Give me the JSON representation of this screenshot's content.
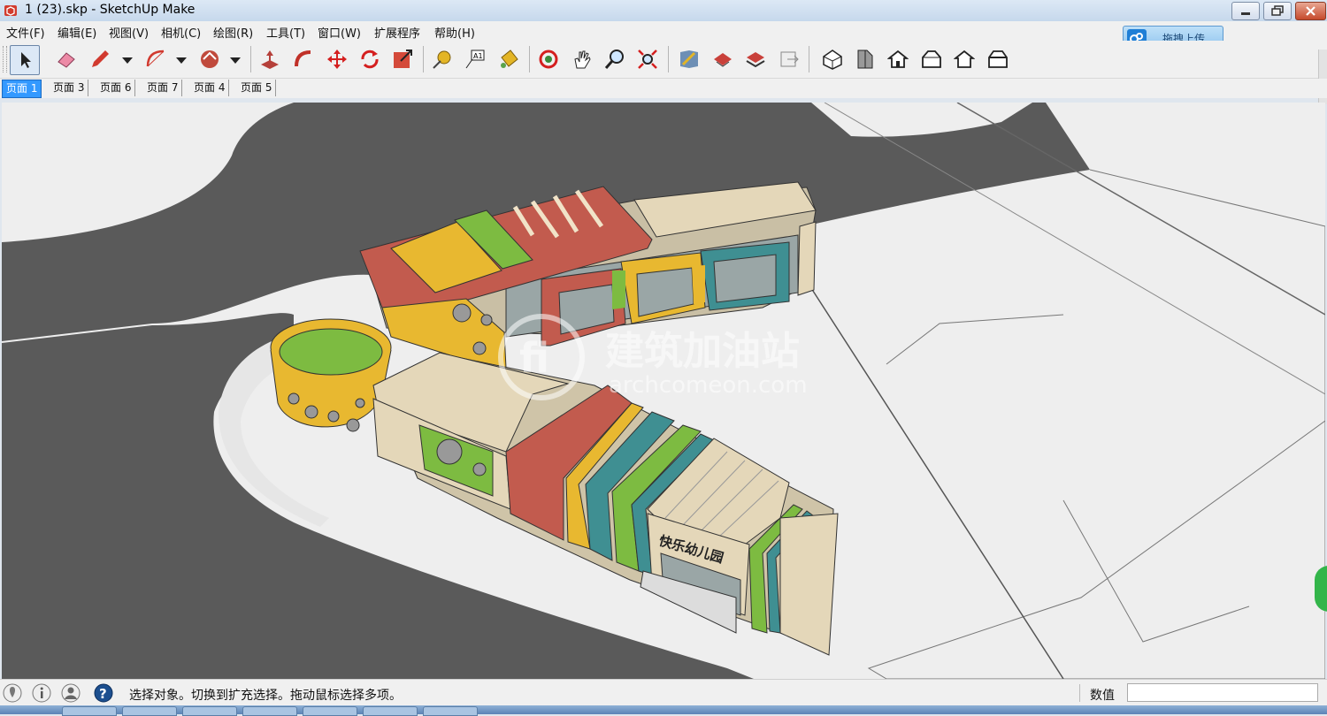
{
  "window": {
    "title": "1 (23).skp - SketchUp Make",
    "app_icon": "sketchup-icon"
  },
  "menu": [
    {
      "label": "文件(F)"
    },
    {
      "label": "编辑(E)"
    },
    {
      "label": "视图(V)"
    },
    {
      "label": "相机(C)"
    },
    {
      "label": "绘图(R)"
    },
    {
      "label": "工具(T)"
    },
    {
      "label": "窗口(W)"
    },
    {
      "label": "扩展程序"
    },
    {
      "label": "帮助(H)"
    }
  ],
  "upload": {
    "label": "拖拽上传",
    "icon": "cloud-upload-icon"
  },
  "tabs": [
    {
      "label": "页面 1",
      "active": true
    },
    {
      "label": "页面 3"
    },
    {
      "label": "页面 6"
    },
    {
      "label": "页面 7"
    },
    {
      "label": "页面 4"
    },
    {
      "label": "页面 5"
    }
  ],
  "toolbar": {
    "tools": [
      "select-icon",
      "eraser-icon",
      "pencil-icon",
      "arc-icon",
      "shape-icon",
      "push-pull-icon",
      "follow-me-icon",
      "move-icon",
      "rotate-icon",
      "scale-icon",
      "tape-measure-icon",
      "text-icon",
      "paint-bucket-icon",
      "orbit-icon",
      "pan-icon",
      "zoom-icon",
      "zoom-extents-icon",
      "3d-warehouse-icon",
      "send-to-layout-icon",
      "extension-warehouse-icon",
      "component-icon",
      "iso-view-icon",
      "top-view-icon",
      "front-view-icon",
      "right-view-icon",
      "back-view-icon",
      "left-view-icon"
    ]
  },
  "viewport": {
    "watermark": {
      "title": "建筑加油站",
      "subtitle": "archcomeon.com"
    },
    "building_sign": "快乐幼儿园"
  },
  "statusbar": {
    "message": "选择对象。切换到扩充选择。拖动鼠标选择多项。",
    "value_label": "数值",
    "value": "",
    "icons": [
      "geo-location-icon",
      "credits-icon",
      "user-icon",
      "help-icon"
    ]
  },
  "colors": {
    "accent": "#3399ff",
    "road": "#595959",
    "ground": "#ececec",
    "red": "#c25b4e",
    "yellow": "#e8b830",
    "green": "#7dbb41",
    "teal": "#3f8f92",
    "beige": "#e4d7b9"
  }
}
